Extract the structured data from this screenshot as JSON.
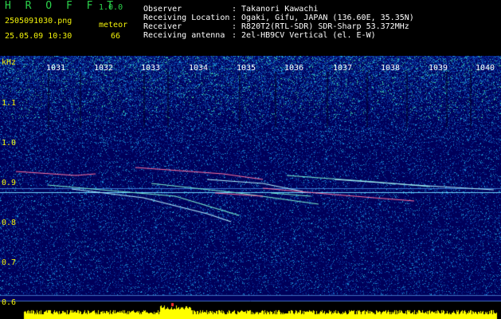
{
  "header": {
    "app_name": "H R O F F T",
    "version": "1.0.0",
    "filename": "2505091030.png",
    "datetime": "25.05.09 10:30",
    "meteor_label": "meteor",
    "meteor_count": "66",
    "info_labels": [
      "Observer",
      "Receiving Location",
      "Receiver",
      "Receiving antenna"
    ],
    "info_values": [
      ": Takanori Kawachi",
      ": Ogaki, Gifu, JAPAN (136.60E, 35.35N)",
      ": R820T2(RTL-SDR) SDR-Sharp 53.372MHz",
      ": 2el-HB9CV Vertical (el. E-W)"
    ]
  },
  "axes": {
    "y_unit": "kHz",
    "y_ticks": [
      "1.1",
      "1.0",
      "0.9",
      "0.8",
      "0.7",
      "0.6"
    ],
    "x_ticks": [
      "1031",
      "1032",
      "1033",
      "1034",
      "1035",
      "1036",
      "1037",
      "1038",
      "1039",
      "1040"
    ]
  },
  "colors": {
    "background": "#000000",
    "spectrum_base": "#00005a",
    "header_yellow": "#f2f20a",
    "header_white": "#ffffff",
    "brand_green": "#2bd24b",
    "signal_bar": "#ffff00"
  }
}
